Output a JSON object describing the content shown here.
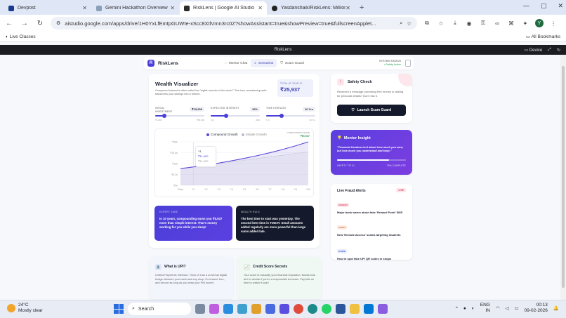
{
  "browser": {
    "tabs": [
      {
        "title": "Devpost",
        "color": "#1a3a8c"
      },
      {
        "title": "Gemini Hackathon Overview",
        "color": "#8aa0b8"
      },
      {
        "title": "RiskLens | Google AI Studio",
        "color": "#2b2b2b"
      },
      {
        "title": "Yasdanshaik/RiskLens: Millions...",
        "color": "#222"
      }
    ],
    "new_tab": "+",
    "url": "aistudio.google.com/apps/drive/1H0YxLfEmtpGUWte-xScc8XtlVmn3rc0Z?showAssistant=true&showPreview=true&fullscreenApplet...",
    "bookmark_live": "Live Classes",
    "bookmark_all": "All Bookmarks",
    "profile_initial": "Y"
  },
  "app_bar": {
    "title": "RiskLens",
    "device": "Device"
  },
  "header": {
    "brand": "RiskLens",
    "logo": "R",
    "tabs": [
      "Mentor Chat",
      "Scenarios",
      "Scam Guard"
    ],
    "status_label": "SYSTEM STATUS",
    "status_value": "• Safety Active"
  },
  "wealth": {
    "title": "Wealth Visualizer",
    "desc": "Compound interest is often called the \"eighth wonder of the world.\" See how consistent growth transforms your savings into a fortune.",
    "total_label": "TOTAL AT YEAR 10",
    "total_value": "₹25,937",
    "sliders": [
      {
        "label": "INITIAL INVESTMENT",
        "value": "₹10,000",
        "min": "₹1,000",
        "max": "₹50,000",
        "pct": 0.18
      },
      {
        "label": "EXPECTED INTEREST",
        "value": "10%",
        "min": "1%",
        "max": "30%",
        "pct": 0.31
      },
      {
        "label": "TIME HORIZON",
        "value": "10 Yrs",
        "min": "1 Yr",
        "max": "30 Yrs",
        "pct": 0.31
      }
    ]
  },
  "chart_data": {
    "type": "area",
    "legend": [
      "Compound Growth",
      "Simple Growth"
    ],
    "colors": [
      "#5a48d8",
      "#b9bccb"
    ],
    "badge_label": "COMPOUNDING EDGE",
    "badge_value": "+₹5,937",
    "x": [
      "Start",
      "Y1",
      "Y2",
      "Y3",
      "Y4",
      "Y5",
      "Y6",
      "Y7",
      "Y8",
      "Y9",
      "Y10"
    ],
    "y_ticks": [
      "₹0k",
      "₹8.3k",
      "₹13k",
      "₹19.5k",
      "₹26k"
    ],
    "ylim": [
      0,
      26000
    ],
    "series": [
      {
        "name": "Compound Growth",
        "values": [
          10000,
          11000,
          12100,
          13310,
          14641,
          16105,
          17716,
          19487,
          21436,
          23579,
          25937
        ]
      },
      {
        "name": "Simple Growth",
        "values": [
          10000,
          11000,
          12000,
          13000,
          14000,
          15000,
          16000,
          17000,
          18000,
          19000,
          20000
        ]
      }
    ],
    "tooltip": {
      "year": "Y1",
      "compound": "₹11,000",
      "simple": "₹11,000"
    }
  },
  "insights": [
    {
      "label": "EXPERT TAKE",
      "text": "In 10 years, compounding earns you ₹5,937 more than simple interest. That's money working for you while you sleep!"
    },
    {
      "label": "WEALTH RULE",
      "text": "The best time to start was yesterday. The second best time is TODAY. Small amounts added regularly are more powerful than large sums added late."
    }
  ],
  "safety": {
    "title": "Safety Check",
    "desc": "Received a message promising free money or asking for personal details? Don't risk it.",
    "button": "Launch Scam Guard"
  },
  "mentor": {
    "title": "Mentor Insight",
    "quote": "\"Financial freedom isn't about how much you earn, but how much you understand and keep.\"",
    "left": "SAFETY TIP 01",
    "right": "75% COMPLETE",
    "progress": 0.75
  },
  "alerts": {
    "title": "Live Fraud Alerts",
    "live": "LIVE",
    "items": [
      {
        "tag": "URGENT",
        "text": "Major bank warns about fake 'Reward Point' SMS",
        "tagBg": "#fde7ec",
        "tagFg": "#e0415b"
      },
      {
        "tag": "ALERT",
        "text": "New 'Remote Access' scams targeting students",
        "tagBg": "#fdece3",
        "tagFg": "#e06a2b"
      },
      {
        "tag": "GUIDE",
        "text": "How to spot fake UPI QR codes in shops",
        "tagBg": "#e8ecfb",
        "tagFg": "#4a5fd9"
      }
    ]
  },
  "info": [
    {
      "title": "What is UPI?",
      "text": "Unified Payments Interface. Think of it as a universal digital bridge between your bank and any shop. It's instant, free, and secure as long as you keep your PIN secret.",
      "icon": "🏦"
    },
    {
      "title": "Credit Score Secrets",
      "text": "Your score is basically your financial reputation. Banks look at it to decide if you're a responsible borrower. Pay bills on time to watch it soar!",
      "icon": "📈"
    }
  ],
  "taskbar": {
    "temp": "24°C",
    "weather": "Mostly clear",
    "search": "Search",
    "lang1": "ENG",
    "lang2": "IN",
    "time": "00:13",
    "date": "09-02-2026"
  }
}
